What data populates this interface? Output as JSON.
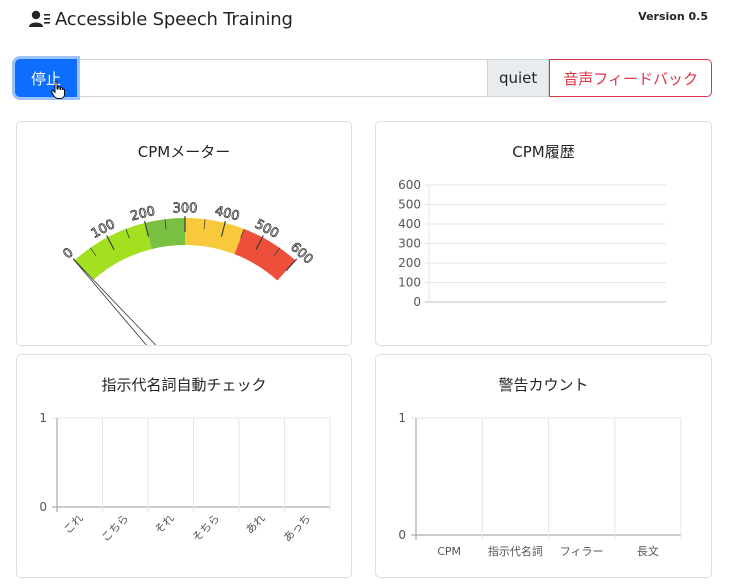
{
  "header": {
    "title": "Accessible Speech Training",
    "version": "Version 0.5",
    "icon": "user-list-icon"
  },
  "controls": {
    "stop_label": "停止",
    "input_value": "",
    "mode_label": "quiet",
    "feedback_label": "音声フィードバック",
    "cursor_icon": "hand-pointer-icon"
  },
  "cards": {
    "cpm_meter": {
      "title": "CPMメーター"
    },
    "cpm_history": {
      "title": "CPM履歴"
    },
    "pronoun_check": {
      "title": "指示代名詞自動チェック"
    },
    "warning_count": {
      "title": "警告カウント"
    }
  },
  "chart_data": [
    {
      "type": "gauge",
      "title": "CPMメーター",
      "ticks": [
        "0",
        "100",
        "200",
        "300",
        "400",
        "500",
        "600"
      ],
      "range": [
        0,
        600
      ],
      "value": 0,
      "bands": [
        {
          "from": 0,
          "to": 200,
          "color": "#a3e01f"
        },
        {
          "from": 200,
          "to": 300,
          "color": "#7ac143"
        },
        {
          "from": 300,
          "to": 450,
          "color": "#f8c93b"
        },
        {
          "from": 450,
          "to": 600,
          "color": "#ee4f3b"
        }
      ]
    },
    {
      "type": "line",
      "title": "CPM履歴",
      "y_ticks": [
        "600",
        "500",
        "400",
        "300",
        "200",
        "100",
        "0"
      ],
      "ylim": [
        0,
        600
      ],
      "series": [],
      "grid": true
    },
    {
      "type": "bar",
      "title": "指示代名詞自動チェック",
      "categories": [
        "これ",
        "こちら",
        "それ",
        "そちら",
        "あれ",
        "あっち"
      ],
      "y_ticks": [
        "1",
        "0"
      ],
      "ylim": [
        0,
        1
      ],
      "values": [
        0,
        0,
        0,
        0,
        0,
        0
      ],
      "grid": true
    },
    {
      "type": "bar",
      "title": "警告カウント",
      "categories": [
        "CPM",
        "指示代名詞",
        "フィラー",
        "長文"
      ],
      "y_ticks": [
        "1",
        "0"
      ],
      "ylim": [
        0,
        1
      ],
      "values": [
        0,
        0,
        0,
        0
      ],
      "grid": true
    }
  ]
}
